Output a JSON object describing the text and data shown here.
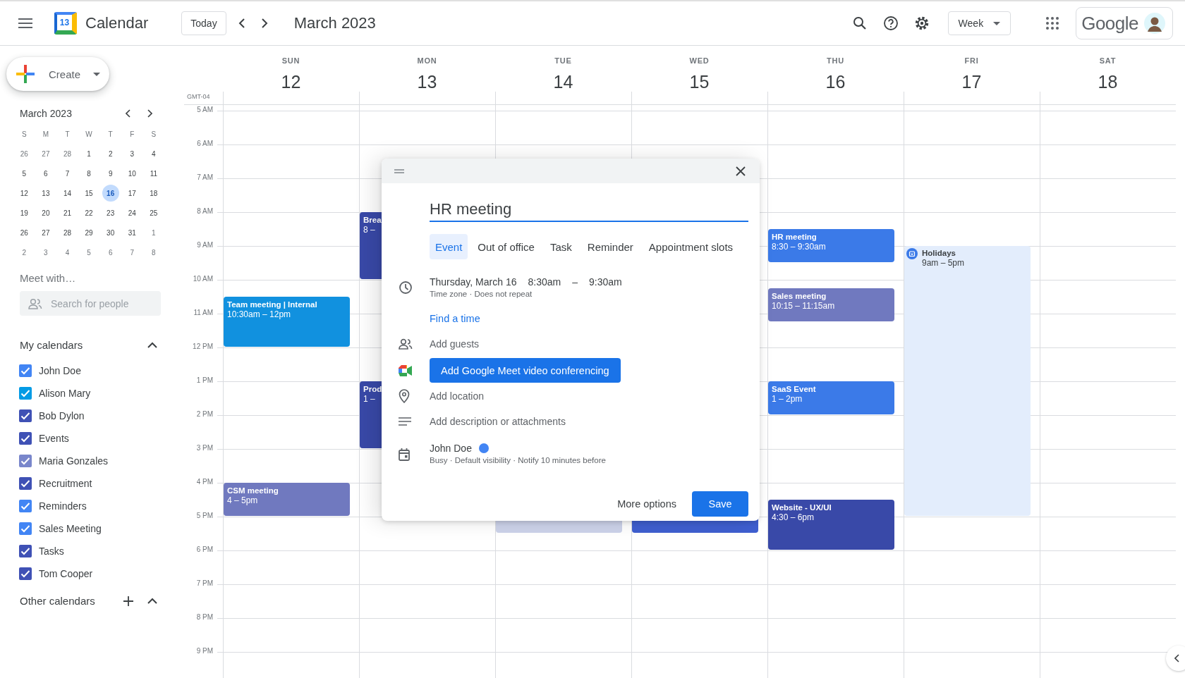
{
  "app": {
    "title": "Calendar",
    "logo_number": "13"
  },
  "toolbar": {
    "today": "Today",
    "period": "March 2023",
    "view": "Week",
    "account": "Google"
  },
  "create": {
    "label": "Create"
  },
  "mini_calendar": {
    "title": "March 2023",
    "weekdays": [
      "S",
      "M",
      "T",
      "W",
      "T",
      "F",
      "S"
    ],
    "days": [
      {
        "label": "26",
        "in_month": false,
        "selected": false
      },
      {
        "label": "27",
        "in_month": false,
        "selected": false
      },
      {
        "label": "28",
        "in_month": false,
        "selected": false
      },
      {
        "label": "1",
        "in_month": true,
        "selected": false
      },
      {
        "label": "2",
        "in_month": true,
        "selected": false
      },
      {
        "label": "3",
        "in_month": true,
        "selected": false
      },
      {
        "label": "4",
        "in_month": true,
        "selected": false
      },
      {
        "label": "5",
        "in_month": true,
        "selected": false
      },
      {
        "label": "6",
        "in_month": true,
        "selected": false
      },
      {
        "label": "7",
        "in_month": true,
        "selected": false
      },
      {
        "label": "8",
        "in_month": true,
        "selected": false
      },
      {
        "label": "9",
        "in_month": true,
        "selected": false
      },
      {
        "label": "10",
        "in_month": true,
        "selected": false
      },
      {
        "label": "11",
        "in_month": true,
        "selected": false
      },
      {
        "label": "12",
        "in_month": true,
        "selected": false
      },
      {
        "label": "13",
        "in_month": true,
        "selected": false
      },
      {
        "label": "14",
        "in_month": true,
        "selected": false
      },
      {
        "label": "15",
        "in_month": true,
        "selected": false
      },
      {
        "label": "16",
        "in_month": true,
        "selected": true
      },
      {
        "label": "17",
        "in_month": true,
        "selected": false
      },
      {
        "label": "18",
        "in_month": true,
        "selected": false
      },
      {
        "label": "19",
        "in_month": true,
        "selected": false
      },
      {
        "label": "20",
        "in_month": true,
        "selected": false
      },
      {
        "label": "21",
        "in_month": true,
        "selected": false
      },
      {
        "label": "22",
        "in_month": true,
        "selected": false
      },
      {
        "label": "23",
        "in_month": true,
        "selected": false
      },
      {
        "label": "24",
        "in_month": true,
        "selected": false
      },
      {
        "label": "25",
        "in_month": true,
        "selected": false
      },
      {
        "label": "26",
        "in_month": true,
        "selected": false
      },
      {
        "label": "27",
        "in_month": true,
        "selected": false
      },
      {
        "label": "28",
        "in_month": true,
        "selected": false
      },
      {
        "label": "29",
        "in_month": true,
        "selected": false
      },
      {
        "label": "30",
        "in_month": true,
        "selected": false
      },
      {
        "label": "31",
        "in_month": true,
        "selected": false
      },
      {
        "label": "1",
        "in_month": false,
        "selected": false
      },
      {
        "label": "2",
        "in_month": false,
        "selected": false
      },
      {
        "label": "3",
        "in_month": false,
        "selected": false
      },
      {
        "label": "4",
        "in_month": false,
        "selected": false
      },
      {
        "label": "5",
        "in_month": false,
        "selected": false
      },
      {
        "label": "6",
        "in_month": false,
        "selected": false
      },
      {
        "label": "7",
        "in_month": false,
        "selected": false
      },
      {
        "label": "8",
        "in_month": false,
        "selected": false
      }
    ]
  },
  "meet": {
    "title": "Meet with…",
    "placeholder": "Search for people"
  },
  "my_calendars": {
    "title": "My calendars",
    "expanded": true,
    "items": [
      {
        "name": "John Doe",
        "checked": true,
        "color": "#4285f4"
      },
      {
        "name": "Alison Mary",
        "checked": true,
        "color": "#039be5"
      },
      {
        "name": "Bob Dylon",
        "checked": true,
        "color": "#3f51b5"
      },
      {
        "name": "Events",
        "checked": true,
        "color": "#3f51b5"
      },
      {
        "name": "Maria Gonzales",
        "checked": true,
        "color": "#7986cb"
      },
      {
        "name": "Recruitment",
        "checked": true,
        "color": "#3f51b5"
      },
      {
        "name": "Reminders",
        "checked": true,
        "color": "#4285f4"
      },
      {
        "name": "Sales Meeting",
        "checked": true,
        "color": "#4285f4"
      },
      {
        "name": "Tasks",
        "checked": true,
        "color": "#3f51b5"
      },
      {
        "name": "Tom Cooper",
        "checked": true,
        "color": "#3f51b5"
      }
    ]
  },
  "other_calendars": {
    "title": "Other calendars",
    "expanded": true
  },
  "timezone": "GMT-04",
  "hours": [
    "5 AM",
    "6 AM",
    "7 AM",
    "8 AM",
    "9 AM",
    "10 AM",
    "11 AM",
    "12 PM",
    "1 PM",
    "2 PM",
    "3 PM",
    "4 PM",
    "5 PM",
    "6 PM",
    "7 PM",
    "8 PM",
    "9 PM"
  ],
  "days": [
    {
      "weekday": "SUN",
      "date": "12",
      "events": [
        {
          "kind": "event",
          "title": "Team meeting | Internal",
          "time": "10:30am – 12pm",
          "color": "#1191df"
        },
        {
          "kind": "event",
          "title": "CSM meeting",
          "time": "4 – 5pm",
          "color": "#7079bf"
        }
      ]
    },
    {
      "weekday": "MON",
      "date": "13",
      "events": [
        {
          "kind": "event",
          "title": "Brea",
          "time": "8 –",
          "color": "#3949a8"
        },
        {
          "kind": "event",
          "title": "Prod",
          "time": "1 –",
          "color": "#3949a8"
        }
      ]
    },
    {
      "weekday": "TUE",
      "date": "14",
      "events": [
        {
          "kind": "event",
          "color": "#cdd3ea"
        }
      ]
    },
    {
      "weekday": "WED",
      "date": "15",
      "events": [
        {
          "kind": "event",
          "color": "#3f5fd0"
        }
      ]
    },
    {
      "weekday": "THU",
      "date": "16",
      "events": [
        {
          "kind": "event",
          "title": "HR meeting",
          "time": "8:30 – 9:30am",
          "color": "#3b7ae8"
        },
        {
          "kind": "event",
          "title": "Sales meeting",
          "time": "10:15 – 11:15am",
          "color": "#7079bf"
        },
        {
          "kind": "event",
          "title": "SaaS Event",
          "time": "1 – 2pm",
          "color": "#3b7ae8"
        },
        {
          "kind": "event",
          "title": "Website - UX/UI",
          "time": "4:30 – 6pm",
          "color": "#3949a8"
        }
      ]
    },
    {
      "weekday": "FRI",
      "date": "17",
      "events": [
        {
          "kind": "holiday",
          "title": "Holidays",
          "time": "9am – 5pm",
          "color": "#e3edfc"
        }
      ]
    },
    {
      "weekday": "SAT",
      "date": "18"
    }
  ],
  "dialog": {
    "title_value": "HR meeting",
    "tabs": [
      {
        "label": "Event",
        "selected": true
      },
      {
        "label": "Out of office",
        "selected": false
      },
      {
        "label": "Task",
        "selected": false
      },
      {
        "label": "Reminder",
        "selected": false
      },
      {
        "label": "Appointment slots",
        "selected": false
      }
    ],
    "date": "Thursday, March 16",
    "start": "8:30am",
    "separator": "–",
    "end": "9:30am",
    "details": "Time zone · Does not repeat",
    "find_time": "Find a time",
    "guests_placeholder": "Add guests",
    "meet_button": "Add Google Meet video conferencing",
    "location_placeholder": "Add location",
    "description_placeholder": "Add description or attachments",
    "calendar": {
      "name": "John Doe",
      "color": "#4285f4"
    },
    "calendar_details": "Busy · Default visibility · Notify 10 minutes before",
    "more_options": "More options",
    "save": "Save"
  }
}
